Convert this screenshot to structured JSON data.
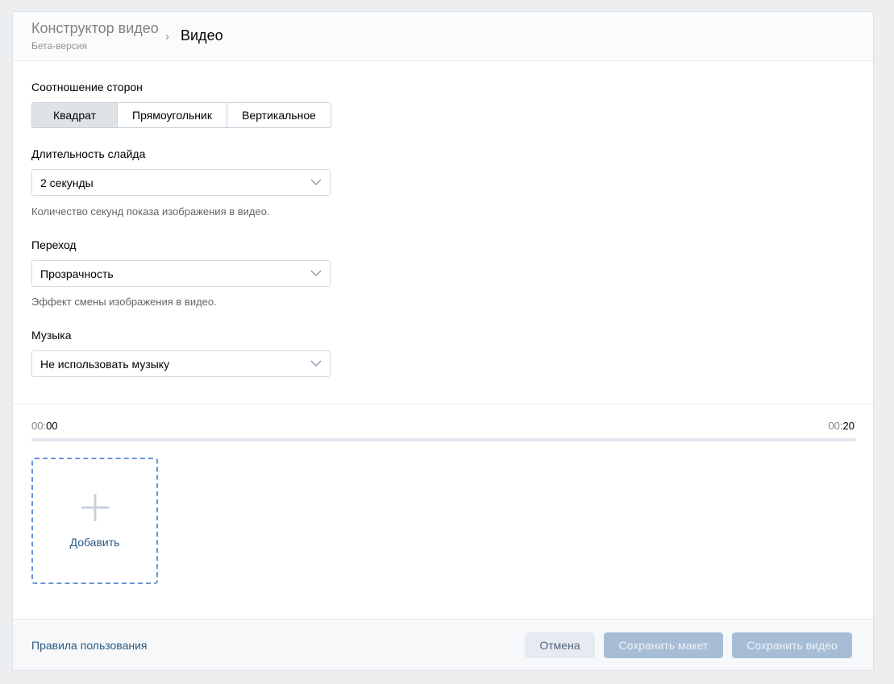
{
  "header": {
    "parent": "Конструктор видео",
    "subtitle": "Бета-версия",
    "separator": "›",
    "current": "Видео"
  },
  "aspect": {
    "label": "Соотношение сторон",
    "options": [
      "Квадрат",
      "Прямоугольник",
      "Вертикальное"
    ],
    "selected": "Квадрат"
  },
  "duration": {
    "label": "Длительность слайда",
    "value": "2 секунды",
    "hint": "Количество секунд показа изображения в видео."
  },
  "transition": {
    "label": "Переход",
    "value": "Прозрачность",
    "hint": "Эффект смены изображения в видео."
  },
  "music": {
    "label": "Музыка",
    "value": "Не использовать музыку"
  },
  "timeline": {
    "start_prefix": "00:",
    "start_suffix": "00",
    "end_prefix": "00:",
    "end_suffix": "20",
    "progress": 0
  },
  "add_tile": {
    "label": "Добавить",
    "icon": "plus-icon"
  },
  "footer": {
    "rules_link": "Правила пользования",
    "cancel": "Отмена",
    "save_layout": "Сохранить макет",
    "save_video": "Сохранить видео"
  },
  "colors": {
    "link": "#2a5885",
    "primary_disabled": "#a7bdd6",
    "dashed_border": "#6b95d4"
  }
}
